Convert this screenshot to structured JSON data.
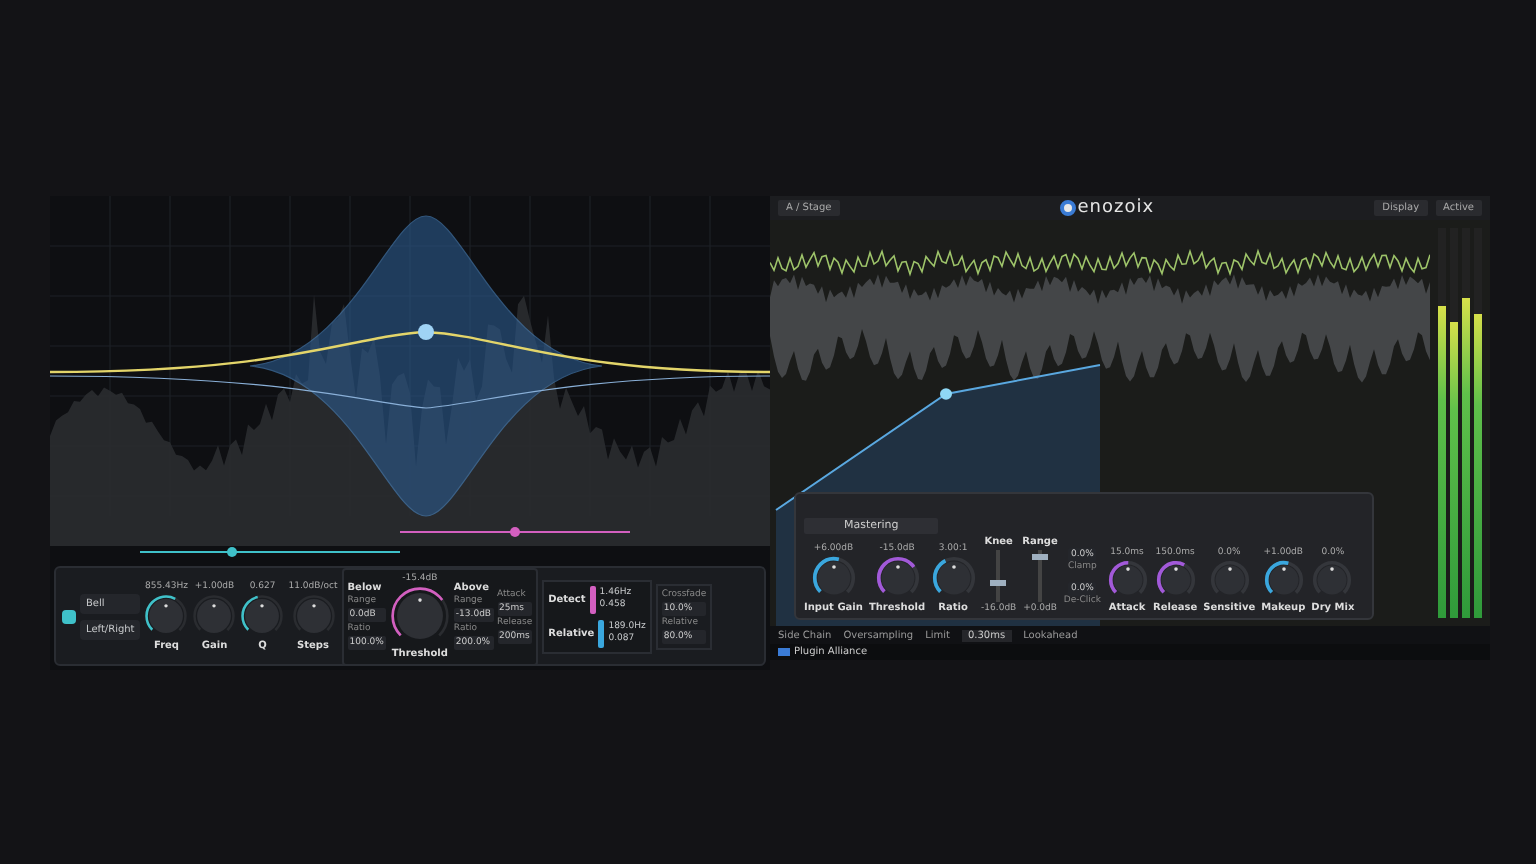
{
  "eq_plugin": {
    "band": {
      "active": true,
      "type": "Bell",
      "channel": "Left/Right"
    },
    "knobs": [
      {
        "label": "Freq",
        "value": "855.43Hz",
        "level": 0.6
      },
      {
        "label": "Gain",
        "value": "+1.00dB",
        "level": 0
      },
      {
        "label": "Q",
        "value": "0.627",
        "level": 0.45
      },
      {
        "label": "Steps",
        "value": "11.0dB/oct",
        "level": 0
      }
    ],
    "below": {
      "title": "Below",
      "fields": [
        {
          "label": "Range",
          "value": "0.0dB"
        },
        {
          "label": "Ratio",
          "value": "100.0%"
        }
      ]
    },
    "threshold": {
      "label": "Threshold",
      "value": "-15.4dB",
      "level": 0.7
    },
    "above": {
      "title": "Above",
      "fields": [
        {
          "label": "Range",
          "value": "-13.0dB"
        },
        {
          "label": "Ratio",
          "value": "200.0%"
        }
      ]
    },
    "timing": [
      {
        "label": "Attack",
        "value": "25ms"
      },
      {
        "label": "Release",
        "value": "200ms"
      }
    ],
    "detectors": [
      {
        "title": "Detect",
        "color": "#d35fc0",
        "freq": "1.46Hz",
        "q": "0.458"
      },
      {
        "title": "Relative",
        "color": "#3aa7de",
        "freq": "189.0Hz",
        "q": "0.087"
      }
    ],
    "mix": [
      {
        "label": "Crossfade",
        "value": "10.0%"
      },
      {
        "label": "Relative",
        "value": "80.0%"
      }
    ],
    "sliders": [
      {
        "color": "#d35fc0",
        "level": 0.5
      },
      {
        "color": "#3fc1c9",
        "level": 0.4
      }
    ]
  },
  "comp_plugin": {
    "toolbar_left": [
      "A / Stage"
    ],
    "logo": "enozoix",
    "toolbar_right": [
      "Display",
      "Active"
    ],
    "preset": "Mastering",
    "knobs": [
      {
        "label": "Input Gain",
        "value": "+6.00dB",
        "level": 0.55,
        "color": "#3aa7de"
      },
      {
        "label": "Threshold",
        "value": "-15.0dB",
        "level": 0.7,
        "color": "#a259d9"
      },
      {
        "label": "Ratio",
        "value": "3.00:1",
        "level": 0.4,
        "color": "#3aa7de"
      }
    ],
    "faders": [
      {
        "label": "Knee",
        "value": "-16.0dB",
        "level": 0.35
      },
      {
        "label": "Range",
        "value": "+0.0dB",
        "level": 0.9
      }
    ],
    "small": [
      {
        "label": "Clamp",
        "value": "0.0%"
      },
      {
        "label": "De-Click",
        "value": "0.0%"
      }
    ],
    "right_knobs": [
      {
        "label": "Attack",
        "value": "15.0ms",
        "level": 0.5,
        "color": "#a259d9"
      },
      {
        "label": "Release",
        "value": "150.0ms",
        "level": 0.6,
        "color": "#a259d9"
      },
      {
        "label": "Sensitive",
        "value": "0.0%",
        "level": 0
      },
      {
        "label": "Makeup",
        "value": "+1.00dB",
        "level": 0.55,
        "color": "#3aa7de"
      },
      {
        "label": "Dry Mix",
        "value": "0.0%",
        "level": 0
      }
    ],
    "status": [
      {
        "label": "Side Chain"
      },
      {
        "label": "Oversampling"
      },
      {
        "label": "Limit",
        "value": "0.30ms"
      },
      {
        "label": "Lookahead"
      }
    ],
    "footer": "Plugin Alliance",
    "meters": [
      {
        "level": 0.8
      },
      {
        "level": 0.76
      },
      {
        "level": 0.82
      },
      {
        "level": 0.78
      }
    ]
  }
}
